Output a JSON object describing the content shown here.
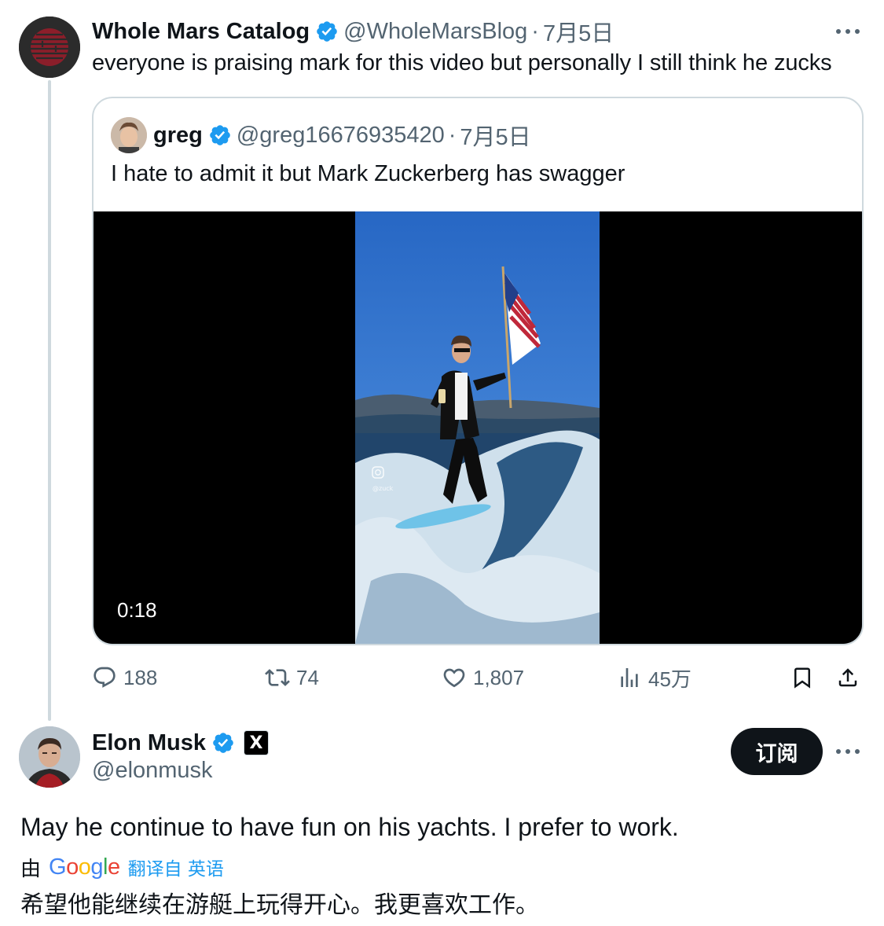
{
  "tweet1": {
    "author": "Whole Mars Catalog",
    "handle": "@WholeMarsBlog",
    "separator": "·",
    "date": "7月5日",
    "text": "everyone is praising mark for this video but personally I still think he zucks"
  },
  "quote": {
    "author": "greg",
    "handle": "@greg16676935420",
    "separator": "·",
    "date": "7月5日",
    "text": "I hate to admit it but Mark Zuckerberg has swagger",
    "video_time": "0:18",
    "watermark": "@zuck"
  },
  "actions": {
    "replies": "188",
    "retweets": "74",
    "likes": "1,807",
    "views": "45万"
  },
  "tweet2": {
    "author": "Elon Musk",
    "affiliate_badge": "X",
    "handle": "@elonmusk",
    "subscribe_label": "订阅",
    "text": "May he continue to have fun on his yachts. I prefer to work.",
    "translate_prefix": "由",
    "translate_provider": "Google",
    "translate_link": "翻译自 英语",
    "translated_text": "希望他能继续在游艇上玩得开心。我更喜欢工作。"
  },
  "colors": {
    "verified_blue": "#1d9bf0",
    "secondary_text": "#536471",
    "border": "#cfd9de",
    "sky_blue": "#2f6fc4"
  }
}
